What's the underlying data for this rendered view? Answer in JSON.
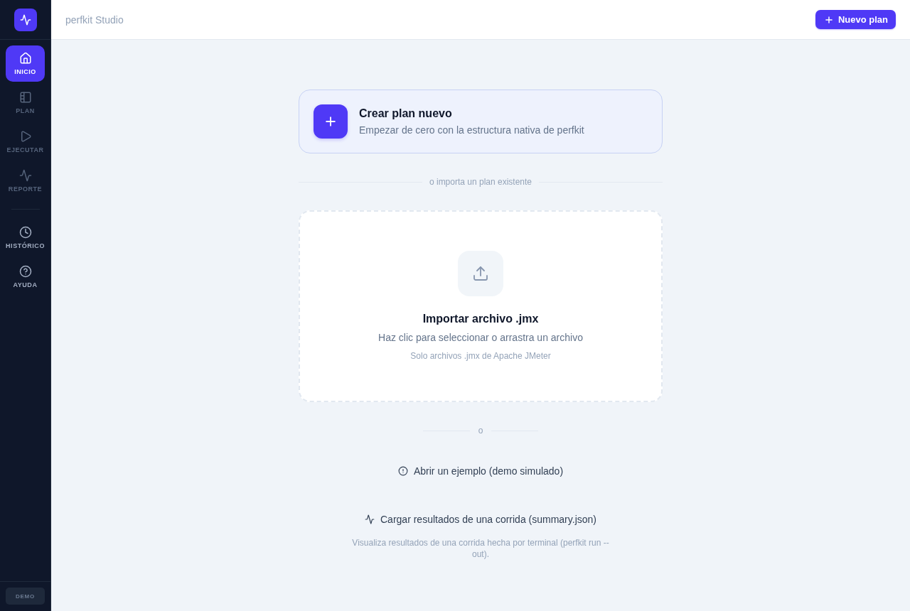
{
  "sidebar": {
    "primary_nav": [
      {
        "label": "INICIO",
        "selected": true,
        "disabled": false
      },
      {
        "label": "PLAN",
        "selected": false,
        "disabled": true
      },
      {
        "label": "EJECUTAR",
        "selected": false,
        "disabled": true
      },
      {
        "label": "REPORTE",
        "selected": false,
        "disabled": true
      }
    ],
    "secondary_nav": [
      {
        "label": "HISTÓRICO",
        "selected": false,
        "disabled": false
      },
      {
        "label": "AYUDA",
        "selected": false,
        "disabled": false
      }
    ],
    "footer_badge": "DEMO"
  },
  "header": {
    "title": "perfkit Studio",
    "new_plan_button": "Nuevo plan"
  },
  "create_card": {
    "title": "Crear plan nuevo",
    "subtitle": "Empezar de cero con la estructura nativa de perfkit"
  },
  "import_divider": "o importa un plan existente",
  "dropzone": {
    "title": "Importar archivo .jmx",
    "subtitle": "Haz clic para seleccionar o arrastra un archivo",
    "hint": "Solo archivos .jmx de Apache JMeter"
  },
  "or_divider": "o",
  "actions": [
    {
      "kind": "example",
      "label": "Abrir un ejemplo (demo simulado)"
    },
    {
      "kind": "results",
      "label": "Cargar resultados de una corrida (summary.json)",
      "description": "Visualiza resultados de una corrida hecha por terminal (perfkit run --out)."
    }
  ]
}
